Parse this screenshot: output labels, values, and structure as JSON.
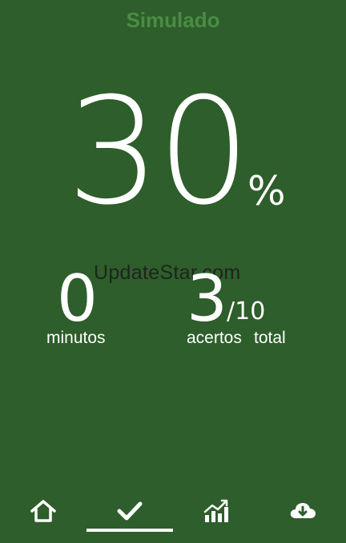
{
  "header": {
    "title": "Simulado"
  },
  "score": {
    "percent": "30",
    "percent_sign": "%"
  },
  "watermark": "UpdateStar.com",
  "stats": {
    "minutes": {
      "value": "0",
      "label": "minutos"
    },
    "correct": {
      "value": "3",
      "label": "acertos"
    },
    "total": {
      "value": "/10",
      "label": "total"
    }
  },
  "nav": {
    "items": [
      {
        "icon": "home-icon"
      },
      {
        "icon": "check-icon",
        "active": true
      },
      {
        "icon": "stats-chart-icon"
      },
      {
        "icon": "cloud-download-icon"
      }
    ]
  },
  "colors": {
    "background": "#2e5e2b",
    "title": "#4a8c44",
    "text": "#ffffff"
  }
}
